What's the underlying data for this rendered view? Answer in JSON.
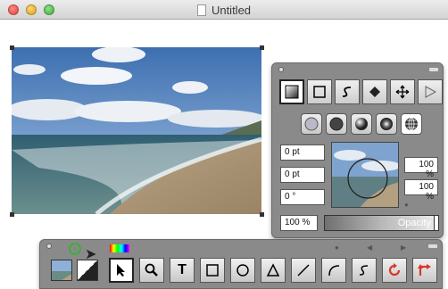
{
  "window": {
    "title": "Untitled"
  },
  "inspector": {
    "tabs": [
      "fill-tab",
      "stroke-tab",
      "curve-tab",
      "diamond-tab",
      "move-tab",
      "play-tab"
    ],
    "brushes": [
      "brush-light",
      "brush-dark",
      "brush-gradient",
      "brush-radial",
      "brush-globe"
    ],
    "fields": {
      "width": "0 pt",
      "height": "0 pt",
      "angle": "0 °",
      "scale_x": "100 %",
      "scale_y": "100 %",
      "opacity_value": "100 %"
    },
    "opacity_label": "Opacity"
  },
  "tools": {
    "items": [
      "select-tool",
      "zoom-tool",
      "text-tool",
      "rectangle-tool",
      "ellipse-tool",
      "triangle-tool",
      "line-tool",
      "arc-tool",
      "curve-tool",
      "rotate-tool",
      "transform-tool"
    ],
    "text_tool_glyph": "T"
  }
}
